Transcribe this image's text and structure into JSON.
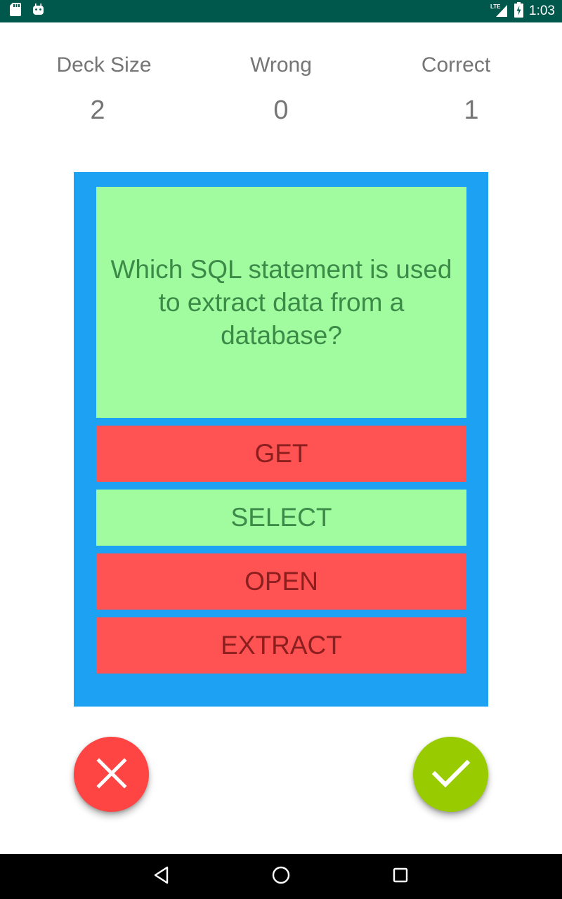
{
  "status_bar": {
    "time": "1:03",
    "network": "LTE",
    "icons": [
      "sd-card-icon",
      "android-icon",
      "signal-icon",
      "battery-charging-icon"
    ]
  },
  "stats": {
    "deck_size": {
      "label": "Deck Size",
      "value": "2"
    },
    "wrong": {
      "label": "Wrong",
      "value": "0"
    },
    "correct": {
      "label": "Correct",
      "value": "1"
    }
  },
  "card": {
    "question": "Which SQL statement is used to extract data from a database?",
    "options": [
      {
        "label": "GET",
        "state": "wrong"
      },
      {
        "label": "SELECT",
        "state": "correct"
      },
      {
        "label": "OPEN",
        "state": "wrong"
      },
      {
        "label": "EXTRACT",
        "state": "wrong"
      }
    ]
  },
  "actions": {
    "wrong_icon": "close-icon",
    "correct_icon": "check-icon"
  },
  "colors": {
    "status_bar": "#00574b",
    "card_border": "#1da1f2",
    "correct_fill": "#a0fc9f",
    "wrong_fill": "#ff5252",
    "fab_wrong": "#ff4444",
    "fab_correct": "#99cc00"
  },
  "nav_bar": {
    "icons": [
      "back-icon",
      "home-icon",
      "recents-icon"
    ]
  }
}
